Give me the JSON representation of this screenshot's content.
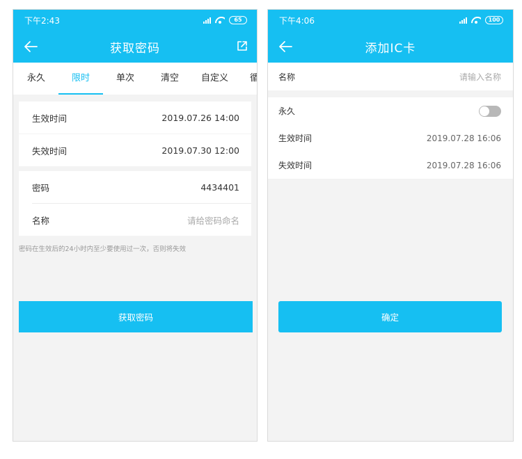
{
  "left": {
    "status": {
      "time": "下午2:43",
      "battery": "65"
    },
    "header": {
      "title": "获取密码"
    },
    "tabs": [
      "永久",
      "限时",
      "单次",
      "清空",
      "自定义",
      "循"
    ],
    "active_tab": 1,
    "time_card": {
      "start_label": "生效时间",
      "start_value": "2019.07.26 14:00",
      "end_label": "失效时间",
      "end_value": "2019.07.30 12:00"
    },
    "password_card": {
      "password_label": "密码",
      "password_value": "4434401",
      "name_label": "名称",
      "name_placeholder": "请给密码命名"
    },
    "hint": "密码在生效后的24小时内至少要使用过一次，否则将失效",
    "button": "获取密码"
  },
  "right": {
    "status": {
      "time": "下午4:06",
      "battery": "100"
    },
    "header": {
      "title": "添加IC卡"
    },
    "name_label": "名称",
    "name_placeholder": "请输入名称",
    "permanent_label": "永久",
    "permanent_on": false,
    "start_label": "生效时间",
    "start_value": "2019.07.28 16:06",
    "end_label": "失效时间",
    "end_value": "2019.07.28 16:06",
    "button": "确定"
  },
  "colors": {
    "accent": "#16bff2",
    "background": "#f3f3f3",
    "toggle_off": "#b8b8b8"
  }
}
